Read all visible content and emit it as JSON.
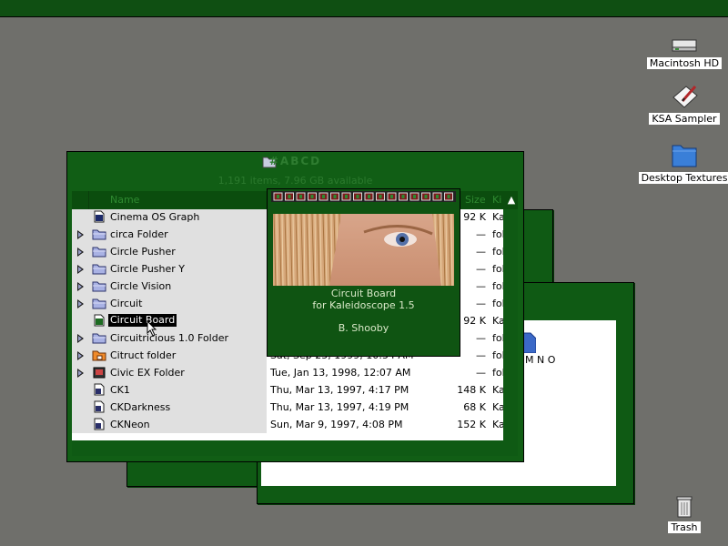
{
  "desktop_icons": {
    "hd": "Macintosh HD",
    "ksa": "KSA Sampler",
    "textures": "Desktop Textures",
    "trash": "Trash"
  },
  "window": {
    "title": "#ABCD",
    "info": "1,191 items, 7.96 GB available",
    "columns": {
      "name": "Name",
      "size": "Size",
      "kind": "Ki"
    }
  },
  "rows": [
    {
      "name": "Cinema OS Graph",
      "date": "",
      "size": "92 K",
      "kind": "Ka",
      "icon": "cinema-file-icon"
    },
    {
      "name": "circa Folder",
      "date": "",
      "size": "—",
      "kind": "fol",
      "icon": "folder-icon"
    },
    {
      "name": "Circle Pusher",
      "date": "",
      "size": "—",
      "kind": "fol",
      "icon": "folder-icon"
    },
    {
      "name": "Circle Pusher Y",
      "date": "",
      "size": "—",
      "kind": "fol",
      "icon": "folder-icon"
    },
    {
      "name": "Circle Vision",
      "date": "",
      "size": "—",
      "kind": "fol",
      "icon": "folder-icon"
    },
    {
      "name": "Circuit",
      "date": "",
      "size": "—",
      "kind": "fol",
      "icon": "folder-icon"
    },
    {
      "name": "Circuit Board",
      "date": "",
      "size": "92 K",
      "kind": "Ka",
      "icon": "circuit-file-icon"
    },
    {
      "name": "Circuitricious 1.0 Folder",
      "date": "",
      "size": "—",
      "kind": "fol",
      "icon": "folder-icon"
    },
    {
      "name": "Citruct folder",
      "date": "Sat, Sep 25, 1999, 10:54 AM",
      "size": "—",
      "kind": "fol",
      "icon": "orange-folder-icon"
    },
    {
      "name": "Civic EX Folder",
      "date": "Tue, Jan 13, 1998, 12:07 AM",
      "size": "—",
      "kind": "fol",
      "icon": "app-folder-icon"
    },
    {
      "name": "CK1",
      "date": "Thu, Mar 13, 1997, 4:17 PM",
      "size": "148 K",
      "kind": "Ka",
      "icon": "document-icon"
    },
    {
      "name": "CKDarkness",
      "date": "Thu, Mar 13, 1997, 4:19 PM",
      "size": "68 K",
      "kind": "Ka",
      "icon": "document-icon"
    },
    {
      "name": "CKNeon",
      "date": "Sun, Mar 9, 1997, 4:08 PM",
      "size": "152 K",
      "kind": "Ka",
      "icon": "document-icon"
    }
  ],
  "preview": {
    "line1": "Circuit Board",
    "line2": "for Kaleidoscope 1.5",
    "line3": "B. Shooby"
  },
  "back_window_text": "M N O",
  "colors": {
    "desktop": "#6f6f6b",
    "window_green": "#115e15",
    "selection": "#000000"
  }
}
